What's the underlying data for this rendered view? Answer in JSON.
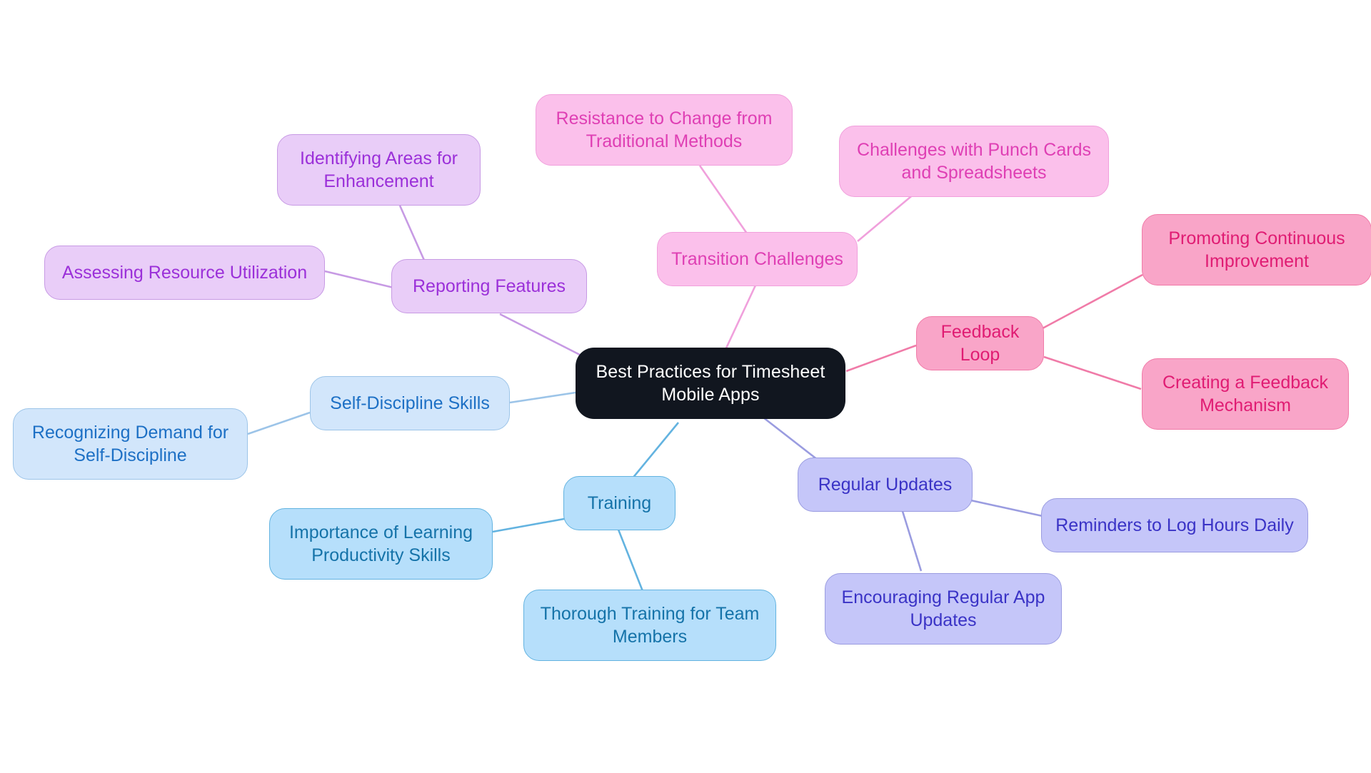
{
  "diagram": {
    "type": "mindmap",
    "title": "Best Practices for Timesheet Mobile Apps",
    "background": "#ffffff"
  },
  "palette": {
    "root_fill": "#11161f",
    "root_text": "#ffffff",
    "purple_fill": "#e9cdf8",
    "purple_text": "#9b30d9",
    "purple_border": "#c79ae4",
    "pink_fill": "#fbc0eb",
    "pink_text": "#df3fb4",
    "pink_border": "#f0a0dc",
    "rose_fill": "#f9a5c8",
    "rose_text": "#e01c73",
    "rose_border": "#f07ba8",
    "periwinkle_fill": "#c5c6f9",
    "periwinkle_text": "#3a33c6",
    "periwinkle_border": "#9a9ce0",
    "cyan_fill": "#b6dffb",
    "cyan_text": "#1573a9",
    "cyan_border": "#63b3e0",
    "lightblue_fill": "#d2e6fb",
    "lightblue_text": "#1d70c5",
    "lightblue_border": "#9cc4e8"
  },
  "nodes": {
    "root": {
      "label": "Best Practices for Timesheet\nMobile Apps"
    },
    "reporting_features": {
      "label": "Reporting Features"
    },
    "assessing_resource_utilization": {
      "label": "Assessing Resource Utilization"
    },
    "identifying_areas_for_enhancement": {
      "label": "Identifying Areas for\nEnhancement"
    },
    "transition_challenges": {
      "label": "Transition Challenges"
    },
    "resistance_to_change": {
      "label": "Resistance to Change from\nTraditional Methods"
    },
    "challenges_punch_cards": {
      "label": "Challenges with Punch Cards\nand Spreadsheets"
    },
    "feedback_loop": {
      "label": "Feedback Loop"
    },
    "promoting_continuous_improvement": {
      "label": "Promoting Continuous\nImprovement"
    },
    "creating_feedback_mechanism": {
      "label": "Creating a Feedback\nMechanism"
    },
    "regular_updates": {
      "label": "Regular Updates"
    },
    "reminders_log_hours": {
      "label": "Reminders to Log Hours Daily"
    },
    "encouraging_regular_app_updates": {
      "label": "Encouraging Regular App\nUpdates"
    },
    "training": {
      "label": "Training"
    },
    "importance_learning_productivity": {
      "label": "Importance of Learning\nProductivity Skills"
    },
    "thorough_training_team": {
      "label": "Thorough Training for Team\nMembers"
    },
    "self_discipline_skills": {
      "label": "Self-Discipline Skills"
    },
    "recognizing_demand_self_discipline": {
      "label": "Recognizing Demand for\nSelf-Discipline"
    }
  },
  "branches": [
    {
      "branch": "Reporting Features",
      "color": "purple",
      "children": [
        "Assessing Resource Utilization",
        "Identifying Areas for Enhancement"
      ]
    },
    {
      "branch": "Transition Challenges",
      "color": "pink",
      "children": [
        "Resistance to Change from Traditional Methods",
        "Challenges with Punch Cards and Spreadsheets"
      ]
    },
    {
      "branch": "Feedback Loop",
      "color": "rose",
      "children": [
        "Promoting Continuous Improvement",
        "Creating a Feedback Mechanism"
      ]
    },
    {
      "branch": "Regular Updates",
      "color": "periwinkle",
      "children": [
        "Reminders to Log Hours Daily",
        "Encouraging Regular App Updates"
      ]
    },
    {
      "branch": "Training",
      "color": "cyan",
      "children": [
        "Importance of Learning Productivity Skills",
        "Thorough Training for Team Members"
      ]
    },
    {
      "branch": "Self-Discipline Skills",
      "color": "lightblue",
      "children": [
        "Recognizing Demand for Self-Discipline"
      ]
    }
  ]
}
